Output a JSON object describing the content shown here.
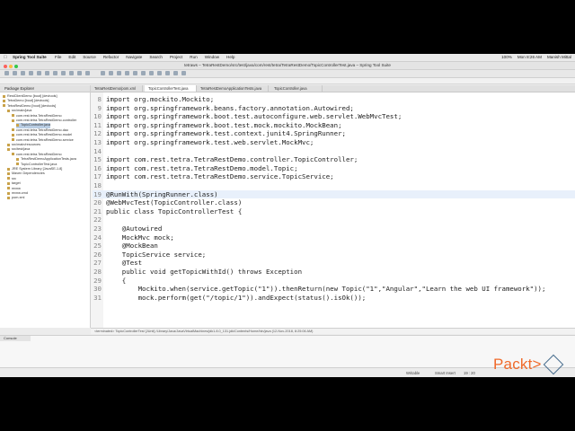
{
  "menubar": {
    "app": "Spring Tool Suite",
    "items": [
      "File",
      "Edit",
      "Source",
      "Refactor",
      "Navigate",
      "Search",
      "Project",
      "Run",
      "Window",
      "Help"
    ],
    "right": [
      "100%",
      "Mon 8:26 AM",
      "Manish Mittal"
    ]
  },
  "window": {
    "title": "tetraws – TetraRestDemo/src/test/java/com/rest/tetra/TetraRestDemo/TopicControllerTest.java – Spring Tool Suite"
  },
  "explorer": {
    "title": "Package Explorer",
    "items": [
      {
        "label": "RestClientDemo [boot] [devtools]",
        "indent": 0
      },
      {
        "label": "TetraDemo [boot] [devtools]",
        "indent": 0
      },
      {
        "label": "TetraRestDemo [boot] [devtools]",
        "indent": 0
      },
      {
        "label": "src/main/java",
        "indent": 1
      },
      {
        "label": "com.rest.tetra.TetraRestDemo",
        "indent": 2
      },
      {
        "label": "com.rest.tetra.TetraRestDemo.controller",
        "indent": 2
      },
      {
        "label": "TopicController.java",
        "indent": 3,
        "selected": true
      },
      {
        "label": "com.rest.tetra.TetraRestDemo.dao",
        "indent": 2
      },
      {
        "label": "com.rest.tetra.TetraRestDemo.model",
        "indent": 2
      },
      {
        "label": "com.rest.tetra.TetraRestDemo.service",
        "indent": 2
      },
      {
        "label": "src/main/resources",
        "indent": 1
      },
      {
        "label": "src/test/java",
        "indent": 1
      },
      {
        "label": "com.rest.tetra.TetraRestDemo",
        "indent": 2
      },
      {
        "label": "TetraRestDemoApplicationTests.java",
        "indent": 3
      },
      {
        "label": "TopicControllerTest.java",
        "indent": 3
      },
      {
        "label": "JRE System Library [JavaSE-1.8]",
        "indent": 1
      },
      {
        "label": "Maven Dependencies",
        "indent": 1
      },
      {
        "label": "src",
        "indent": 1
      },
      {
        "label": "target",
        "indent": 1
      },
      {
        "label": "mvnw",
        "indent": 1
      },
      {
        "label": "mvnw.cmd",
        "indent": 1
      },
      {
        "label": "pom.xml",
        "indent": 1
      }
    ]
  },
  "tabs": [
    {
      "label": "TetraRestDemo/pom.xml",
      "active": false
    },
    {
      "label": "TopicControllerTest.java",
      "active": true
    },
    {
      "label": "TetraRestDemoApplicationTests.java",
      "active": false
    },
    {
      "label": "TopicController.java",
      "active": false
    }
  ],
  "code": [
    {
      "n": "8",
      "text": "import org.mockito.Mockito;"
    },
    {
      "n": "9",
      "text": "import org.springframework.beans.factory.annotation.Autowired;"
    },
    {
      "n": "10",
      "text": "import org.springframework.boot.test.autoconfigure.web.servlet.WebMvcTest;"
    },
    {
      "n": "11",
      "text": "import org.springframework.boot.test.mock.mockito.MockBean;"
    },
    {
      "n": "12",
      "text": "import org.springframework.test.context.junit4.SpringRunner;"
    },
    {
      "n": "13",
      "text": "import org.springframework.test.web.servlet.MockMvc;"
    },
    {
      "n": "14",
      "text": ""
    },
    {
      "n": "15",
      "text": "import com.rest.tetra.TetraRestDemo.controller.TopicController;"
    },
    {
      "n": "16",
      "text": "import com.rest.tetra.TetraRestDemo.model.Topic;"
    },
    {
      "n": "17",
      "text": "import com.rest.tetra.TetraRestDemo.service.TopicService;"
    },
    {
      "n": "18",
      "text": ""
    },
    {
      "n": "19",
      "text": "@RunWith(SpringRunner.class)",
      "highlight": true
    },
    {
      "n": "20",
      "text": "@WebMvcTest(TopicController.class)"
    },
    {
      "n": "21",
      "text": "public class TopicControllerTest {"
    },
    {
      "n": "22",
      "text": ""
    },
    {
      "n": "23",
      "text": "    @Autowired"
    },
    {
      "n": "24",
      "text": "    MockMvc mock;"
    },
    {
      "n": "25",
      "text": "    @MockBean"
    },
    {
      "n": "26",
      "text": "    TopicService service;"
    },
    {
      "n": "27",
      "text": "    @Test"
    },
    {
      "n": "28",
      "text": "    public void getTopicWithId() throws Exception"
    },
    {
      "n": "29",
      "text": "    {"
    },
    {
      "n": "30",
      "text": "        Mockito.when(service.getTopic(\"1\")).thenReturn(new Topic(\"1\",\"Angular\",\"Learn the web UI framework\"));"
    },
    {
      "n": "31",
      "text": "        mock.perform(get(\"/topic/1\")).andExpect(status().isOk());"
    }
  ],
  "status_text": "<terminated> TopicControllerTest [JUnit] /Library/Java/JavaVirtualMachines/jdk1.8.0_131.jdk/Contents/Home/bin/java (12-Nov-2018, 8:25:06 AM)",
  "console": {
    "tab": "Console"
  },
  "bottom": {
    "writable": "Writable",
    "insert": "Smart Insert",
    "position": "19 : 20"
  },
  "brand": {
    "name": "Packt>",
    "color": "#f06a2a"
  }
}
